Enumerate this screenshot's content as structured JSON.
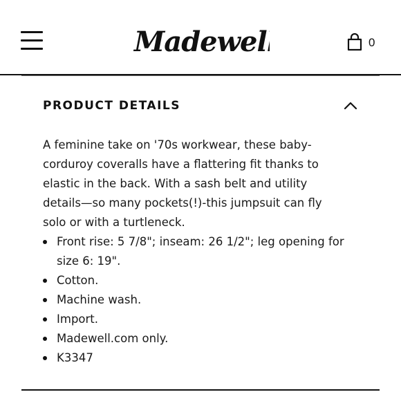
{
  "header": {
    "menu_icon": "hamburger-menu-icon",
    "logo_text": "Madewell",
    "bag_icon": "shopping-bag-icon",
    "bag_count": "0"
  },
  "product_details": {
    "title": "PRODUCT DETAILS",
    "toggle_icon": "chevron-up-icon",
    "description": "A feminine take on '70s workwear, these baby-corduroy coveralls have a flattering fit thanks to elastic in the back. With a sash belt and utility details—so many pockets(!)-this jumpsuit can fly solo or with a turtleneck.",
    "bullets": [
      "Front rise: 5 7/8\"; inseam: 26 1/2\"; leg opening for size 6: 19\".",
      "Cotton.",
      "Machine wash.",
      "Import.",
      "Madewell.com only.",
      "K3347"
    ]
  },
  "colors": {
    "text": "#1a1a1a",
    "rule": "#111111",
    "background": "#ffffff"
  }
}
